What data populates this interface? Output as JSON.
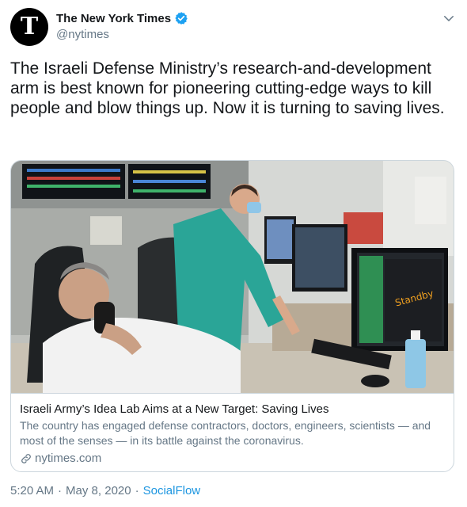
{
  "header": {
    "avatar_letter": "T",
    "name": "The New York Times",
    "handle": "@nytimes",
    "verified_color": "#1da1f2"
  },
  "tweet": {
    "text": "The Israeli Defense Ministry’s research-and-development arm is best known for pioneering cutting-edge ways to kill people and blow things up. Now it is turning to saving lives."
  },
  "card": {
    "image_subject": "medical lab with computer monitors, man in green scrubs and seated man on phone",
    "image_sign_text": "Standby",
    "title": "Israeli Army’s Idea Lab Aims at a New Target: Saving Lives",
    "description": "The country has engaged defense contractors, doctors, engineers, scientists — and most of the senses — in its battle against the coronavirus.",
    "domain": "nytimes.com"
  },
  "meta": {
    "time": "5:20 AM",
    "separator": "·",
    "date": "May 8, 2020",
    "source": "SocialFlow"
  },
  "colors": {
    "text": "#14171a",
    "secondary": "#657786",
    "link": "#1b95e0",
    "border": "#ccd6dd"
  }
}
